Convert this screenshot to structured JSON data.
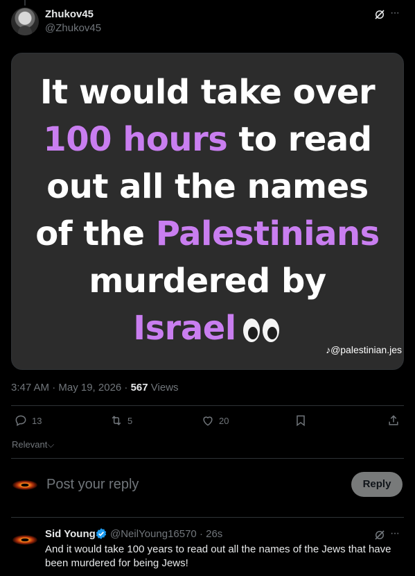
{
  "post": {
    "display_name": "Zhukov45",
    "handle": "@Zhukov45",
    "media": {
      "line1": "It would take over",
      "line2_highlight": "100 hours",
      "line2_rest": " to read",
      "line3": "out all the names",
      "line4_start": "of the ",
      "line4_highlight": "Palestinians",
      "line5_highlight": "murdered by",
      "line6_highlight": "Israel",
      "watermark": "@palestinian.jes",
      "highlight_color": "#c97ef0"
    },
    "timestamp": "3:47 AM · May 19, 2026 · ",
    "views_count": "567",
    "views_label": " Views",
    "stats": {
      "replies": "13",
      "reposts": "5",
      "likes": "20"
    }
  },
  "sort": {
    "label": "Relevant"
  },
  "reply_composer": {
    "placeholder": "Post your reply",
    "button_label": "Reply"
  },
  "comments": [
    {
      "display_name": "Sid Young",
      "handle_time": "@NeilYoung16570 · 26s",
      "text": "And it would take 100 years to read out all the names of the Jews that have been murdered for being Jews!"
    }
  ]
}
